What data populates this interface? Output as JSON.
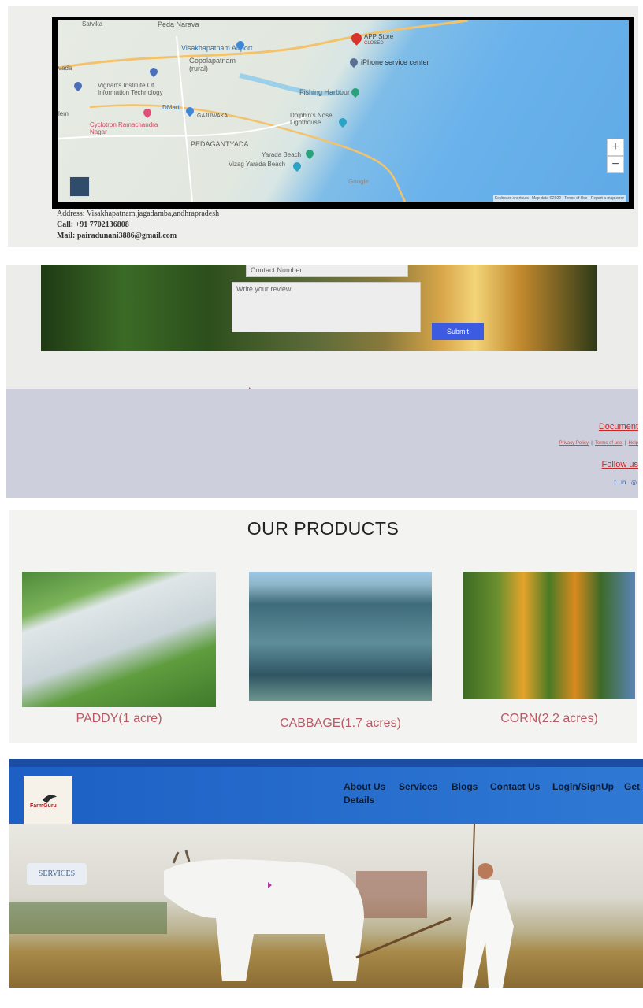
{
  "map": {
    "places": {
      "peda_narava": "Peda Narava",
      "airport": "Visakhapatnam Airport",
      "gopalapatnam": "Gopalapatnam (rural)",
      "vignan": "Vignan's Institute Of Information Technology",
      "dmart": "DMart",
      "gajuwaka": "GAJUWAKA",
      "cyclotron": "Cyclotron Ramachandra Nagar",
      "pedagantyada": "PEDAGANTYADA",
      "fishing_harbour": "Fishing Harbour",
      "dolphins_nose": "Dolphin's Nose Lighthouse",
      "yarada_beach": "Yarada Beach",
      "vizag_yarada_beach": "Vizag Yarada Beach",
      "app_store": "APP Store",
      "app_store_status": "CLOSED",
      "iphone_service": "iPhone service center",
      "satvika": "Satvika",
      "vada": "vada",
      "lem": "lem",
      "google": "Google"
    },
    "attribution": [
      "Keyboard shortcuts",
      "Map data ©2022",
      "Terms of Use",
      "Report a map error"
    ],
    "zoom_in": "+",
    "zoom_out": "−"
  },
  "contact": {
    "address": "Address: Visakhapatnam,jagadamba,andhrapradesh",
    "call": "Call: +91 7702136808",
    "mail": "Mail: pairadunani3886@gmail.com"
  },
  "review_form": {
    "contact_placeholder": "Contact Number",
    "review_placeholder": "Write your review",
    "submit_label": "Submit"
  },
  "footer": {
    "documents_heading": "Document",
    "links": [
      "Privacy Policy",
      "Terms of use",
      "Help"
    ],
    "separator": "|",
    "follow_heading": "Follow us",
    "social": [
      "f",
      "in",
      "◎"
    ]
  },
  "products": {
    "title": "OUR PRODUCTS",
    "items": [
      {
        "caption": "PADDY(1 acre)"
      },
      {
        "caption": "CABBAGE(1.7 acres)"
      },
      {
        "caption": "CORN(2.2 acres)"
      }
    ]
  },
  "header": {
    "logo_text": "FarmGuru",
    "nav": [
      "About Us",
      "Services",
      "Blogs",
      "Contact Us",
      "Login/SignUp",
      "Get"
    ],
    "nav_second_line": "Details"
  },
  "hero": {
    "services_button": "SERVICES"
  },
  "colors": {
    "nav_blue": "#2366c8",
    "submit_blue": "#3c5be0",
    "footer_link_red": "#c62828",
    "product_caption": "#b85a66"
  }
}
